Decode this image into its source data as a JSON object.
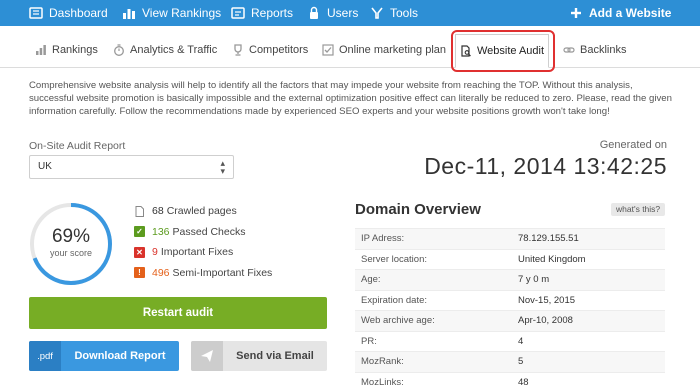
{
  "nav": {
    "dashboard": "Dashboard",
    "view_rankings": "View Rankings",
    "reports": "Reports",
    "users": "Users",
    "tools": "Tools",
    "add_website": "Add a Website"
  },
  "tabs": [
    {
      "label": "Rankings",
      "icon": "bar-chart-icon"
    },
    {
      "label": "Analytics & Traffic",
      "icon": "stopwatch-icon"
    },
    {
      "label": "Competitors",
      "icon": "trophy-icon"
    },
    {
      "label": "Online marketing plan",
      "icon": "checkbox-icon"
    },
    {
      "label": "Website Audit",
      "icon": "document-search-icon",
      "active": true
    },
    {
      "label": "Backlinks",
      "icon": "link-icon"
    }
  ],
  "intro": "Comprehensive website analysis will help to identify all the factors that may impede your website from reaching the TOP. Without this analysis, successful website promotion is basically impossible and the external optimization positive effect can literally be reduced to zero. Please, read the given information carefully. Follow the recommendations made by experienced SEO experts and your website positions growth won't take long!",
  "report": {
    "label": "On-Site Audit Report",
    "region": "UK"
  },
  "generated": {
    "label": "Generated on",
    "date": "Dec-11, 2014 13:42:25"
  },
  "score": {
    "value": "69%",
    "fraction": 0.69,
    "caption": "your score",
    "color": "#3a98e0"
  },
  "stats": {
    "crawled_num": "68",
    "crawled_label": "Crawled pages",
    "passed_num": "136",
    "passed_label": "Passed Checks",
    "important_num": "9",
    "important_label": "Important Fixes",
    "semi_num": "496",
    "semi_label": "Semi-Important Fixes"
  },
  "buttons": {
    "restart": "Restart audit",
    "pdf_tag": ".pdf",
    "download": "Download Report",
    "email": "Send via Email"
  },
  "overview": {
    "title": "Domain Overview",
    "whats_this": "what's this?",
    "rows": [
      {
        "key": "IP Adress:",
        "value": "78.129.155.51"
      },
      {
        "key": "Server location:",
        "value": "United Kingdom"
      },
      {
        "key": "Age:",
        "value": "7 y 0 m"
      },
      {
        "key": "Expiration date:",
        "value": "Nov-15, 2015"
      },
      {
        "key": "Web archive age:",
        "value": "Apr-10, 2008"
      },
      {
        "key": "PR:",
        "value": "4"
      },
      {
        "key": "MozRank:",
        "value": "5"
      },
      {
        "key": "MozLinks:",
        "value": "48"
      }
    ]
  },
  "colors": {
    "nav_bg": "#2d8fd5",
    "restart_green": "#77ad25",
    "download_blue": "#3a98e0",
    "highlight_red": "#e03030"
  }
}
